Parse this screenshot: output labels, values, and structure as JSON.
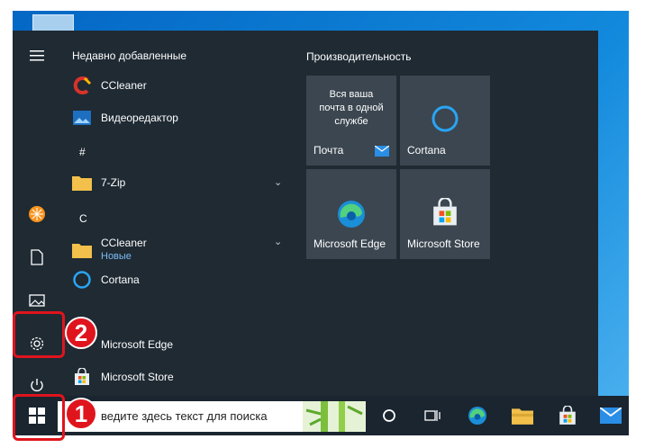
{
  "start_menu": {
    "recent_header": "Недавно добавленные",
    "productivity_header": "Производительность",
    "apps": [
      {
        "label": "CCleaner"
      },
      {
        "label": "Видеоредактор"
      },
      {
        "group": "#"
      },
      {
        "label": "7-Zip"
      },
      {
        "group": "C"
      },
      {
        "label": "CCleaner",
        "sub": "Новые"
      },
      {
        "label": "Cortana"
      },
      {
        "label": "Microsoft Edge"
      },
      {
        "label": "Microsoft Store"
      }
    ],
    "tiles": {
      "mail_title": "Вся ваша почта в одной службе",
      "mail": "Почта",
      "cortana": "Cortana",
      "edge": "Microsoft Edge",
      "store": "Microsoft Store"
    }
  },
  "taskbar": {
    "search_placeholder": "ведите здесь текст для поиска"
  },
  "annotations": {
    "step1": "1",
    "step2": "2"
  },
  "colors": {
    "accent_red": "#e0141d",
    "start_bg": "#1f2a33",
    "tile_bg": "#3b4650"
  }
}
